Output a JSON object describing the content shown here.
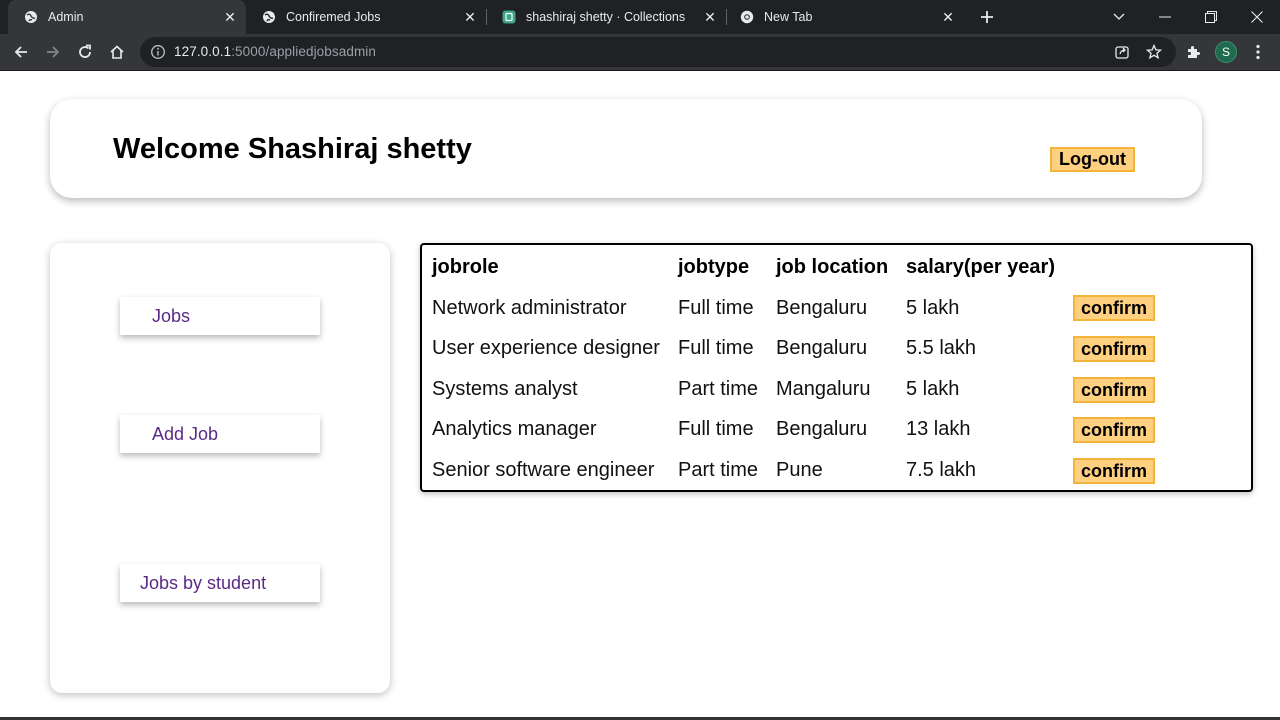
{
  "browser": {
    "tabs": [
      {
        "title": "Admin"
      },
      {
        "title": "Confiremed Jobs"
      },
      {
        "title": "shashiraj shetty · Collections"
      },
      {
        "title": "New Tab"
      }
    ],
    "url_host": "127.0.0.1",
    "url_path": ":5000/appliedjobsadmin",
    "profile_initial": "S"
  },
  "header": {
    "welcome": "Welcome Shashiraj shetty",
    "logout_label": "Log-out"
  },
  "sidebar": {
    "items": [
      {
        "label": "Jobs"
      },
      {
        "label": "Add Job"
      },
      {
        "label": "Jobs by student"
      }
    ]
  },
  "jobs_table": {
    "columns": [
      "jobrole",
      "jobtype",
      "job location",
      "salary(per year)"
    ],
    "action_label": "confirm",
    "rows": [
      {
        "jobrole": "Network administrator",
        "jobtype": "Full time",
        "location": "Bengaluru",
        "salary": "5 lakh"
      },
      {
        "jobrole": "User experience designer",
        "jobtype": "Full time",
        "location": "Bengaluru",
        "salary": "5.5 lakh"
      },
      {
        "jobrole": "Systems analyst",
        "jobtype": "Part time",
        "location": "Mangaluru",
        "salary": "5 lakh"
      },
      {
        "jobrole": "Analytics manager",
        "jobtype": "Full time",
        "location": "Bengaluru",
        "salary": "13 lakh"
      },
      {
        "jobrole": "Senior software engineer",
        "jobtype": "Part time",
        "location": "Pune",
        "salary": "7.5 lakh"
      }
    ]
  },
  "colors": {
    "button_fill": "#ffd080",
    "button_border": "#f4b43a",
    "sidebar_link": "#5b2a86",
    "chrome_dark": "#202124",
    "chrome_toolbar": "#35363a"
  },
  "icons": [
    "globe-icon",
    "close-icon",
    "collections-icon",
    "chrome-icon",
    "plus-icon",
    "chevron-down-icon",
    "minimize-icon",
    "restore-icon",
    "back-icon",
    "forward-icon",
    "reload-icon",
    "home-icon",
    "info-icon",
    "share-icon",
    "star-icon",
    "extensions-icon",
    "more-icon"
  ]
}
